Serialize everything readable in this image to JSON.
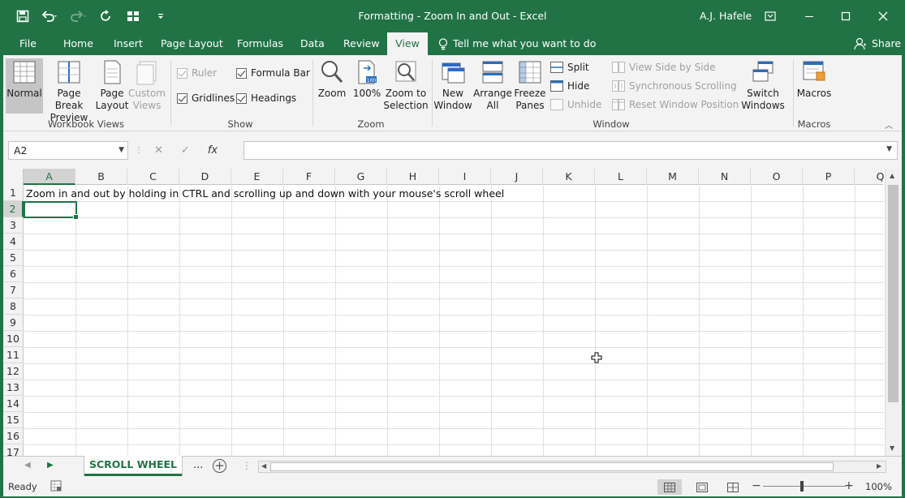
{
  "window": {
    "title": "Formatting - Zoom In and Out  -  Excel",
    "user": "A.J. Hafele"
  },
  "tabs": [
    {
      "label": "File"
    },
    {
      "label": "Home"
    },
    {
      "label": "Insert"
    },
    {
      "label": "Page Layout"
    },
    {
      "label": "Formulas"
    },
    {
      "label": "Data"
    },
    {
      "label": "Review"
    },
    {
      "label": "View"
    }
  ],
  "tell_me": "Tell me what you want to do",
  "share": "Share",
  "ribbon": {
    "workbook_views": {
      "label": "Workbook Views",
      "normal": "Normal",
      "page_break_1": "Page Break",
      "page_break_2": "Preview",
      "page_layout_1": "Page",
      "page_layout_2": "Layout",
      "custom_views_1": "Custom",
      "custom_views_2": "Views"
    },
    "show": {
      "label": "Show",
      "ruler": "Ruler",
      "formula_bar": "Formula Bar",
      "gridlines": "Gridlines",
      "headings": "Headings"
    },
    "zoom": {
      "label": "Zoom",
      "zoom": "Zoom",
      "hundred": "100%",
      "to_sel_1": "Zoom to",
      "to_sel_2": "Selection"
    },
    "window": {
      "label": "Window",
      "new_1": "New",
      "new_2": "Window",
      "arrange_1": "Arrange",
      "arrange_2": "All",
      "freeze_1": "Freeze",
      "freeze_2": "Panes",
      "split": "Split",
      "hide": "Hide",
      "unhide": "Unhide",
      "side_by_side": "View Side by Side",
      "sync_scroll": "Synchronous Scrolling",
      "reset_pos": "Reset Window Position",
      "switch_1": "Switch",
      "switch_2": "Windows"
    },
    "macros": {
      "label": "Macros",
      "macros": "Macros"
    }
  },
  "formula_bar": {
    "name_box": "A2",
    "fx": "fx",
    "value": ""
  },
  "grid": {
    "columns": [
      "A",
      "B",
      "C",
      "D",
      "E",
      "F",
      "G",
      "H",
      "I",
      "J",
      "K",
      "L",
      "M",
      "N",
      "O",
      "P",
      "Q"
    ],
    "rows": [
      "1",
      "2",
      "3",
      "4",
      "5",
      "6",
      "7",
      "8",
      "9",
      "10",
      "11",
      "12",
      "13",
      "14",
      "15",
      "16",
      "17"
    ],
    "a1": "Zoom in and out by holding in CTRL and scrolling up and down with your mouse's scroll wheel"
  },
  "sheets": {
    "active": "SCROLL WHEEL",
    "more": "..."
  },
  "status": {
    "ready": "Ready",
    "zoom_pct": "100%"
  }
}
